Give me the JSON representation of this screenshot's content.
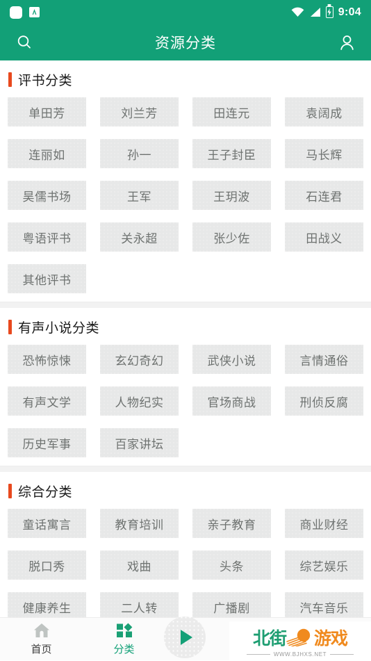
{
  "status_bar": {
    "time": "9:04",
    "icons": [
      "notification-dot-icon",
      "app-badge-icon",
      "wifi-icon",
      "cellular-signal-icon",
      "battery-charging-icon"
    ]
  },
  "app_bar": {
    "title": "资源分类",
    "search_icon": "search-icon",
    "profile_icon": "person-icon"
  },
  "sections": [
    {
      "title": "评书分类",
      "items": [
        "单田芳",
        "刘兰芳",
        "田连元",
        "袁阔成",
        "连丽如",
        "孙一",
        "王子封臣",
        "马长辉",
        "昊儒书场",
        "王军",
        "王玥波",
        "石连君",
        "粤语评书",
        "关永超",
        "张少佐",
        "田战义",
        "其他评书"
      ]
    },
    {
      "title": "有声小说分类",
      "items": [
        "恐怖惊悚",
        "玄幻奇幻",
        "武侠小说",
        "言情通俗",
        "有声文学",
        "人物纪实",
        "官场商战",
        "刑侦反腐",
        "历史军事",
        "百家讲坛"
      ]
    },
    {
      "title": "综合分类",
      "items": [
        "童话寓言",
        "教育培训",
        "亲子教育",
        "商业财经",
        "脱口秀",
        "戏曲",
        "头条",
        "综艺娱乐",
        "健康养生",
        "二人转",
        "广播剧",
        "汽车音乐"
      ]
    }
  ],
  "bottom_nav": {
    "items": [
      {
        "label": "首页",
        "icon": "home-icon",
        "active": false
      },
      {
        "label": "分类",
        "icon": "grid-categories-icon",
        "active": true
      }
    ],
    "play_button": {
      "icon": "play-icon"
    }
  },
  "watermark": {
    "text_left": "北街",
    "text_right": "游戏",
    "url": "WWW.BJHXS.NET"
  },
  "colors": {
    "brand_green": "#12A077",
    "accent_orange": "#E8491E",
    "tile_bg": "#E7E8E8",
    "tile_text": "#6E7270",
    "watermark_teal": "#1E9E72",
    "watermark_orange": "#F08A1E"
  }
}
